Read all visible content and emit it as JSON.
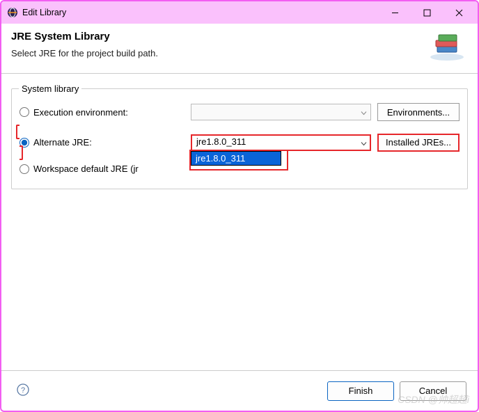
{
  "window": {
    "title": "Edit Library"
  },
  "header": {
    "title": "JRE System Library",
    "subtitle": "Select JRE for the project build path."
  },
  "group": {
    "legend": "System library",
    "rows": {
      "exec_env": {
        "label": "Execution environment:",
        "value": "",
        "button": "Environments..."
      },
      "alternate": {
        "label": "Alternate JRE:",
        "value": "jre1.8.0_311",
        "button": "Installed JREs..."
      },
      "workspace": {
        "label_prefix": "Workspace default JRE (",
        "label_suffix_hidden": "jr"
      }
    }
  },
  "dropdown": {
    "item": "jre1.8.0_311"
  },
  "footer": {
    "finish": "Finish",
    "cancel": "Cancel"
  },
  "watermark": "CSDN @帅超超i"
}
